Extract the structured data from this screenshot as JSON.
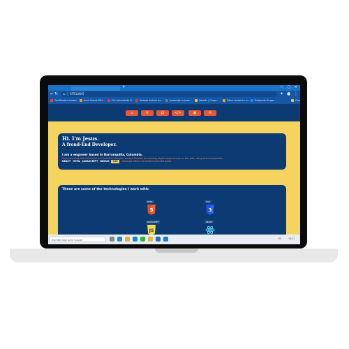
{
  "browser": {
    "tab_title": "SITELINKS",
    "new_tab_glyph": "+",
    "window_controls": "— ▢ ✕",
    "url_text": "① ⓘ SITELINKS",
    "bookmarks": [
      {
        "label": "Certificados Acaden...",
        "color": "#e74c3c"
      },
      {
        "label": "Acad Virtual IPN I...",
        "color": "#f39c12"
      },
      {
        "label": "Clic Actualizado G...",
        "color": "#e53935"
      },
      {
        "label": "Portada Archivo de...",
        "color": "#e53935"
      },
      {
        "label": "Javascript vs Java:...",
        "color": "#607d8b"
      },
      {
        "label": "Gestión | Grupo...",
        "color": "#fbc02d"
      },
      {
        "label": "Cómo vender tu cu...",
        "color": "#f39c12"
      },
      {
        "label": "Endpoints Grupo...",
        "color": "#1e88e5"
      },
      {
        "label": "Otros",
        "color": "#fbc02d"
      }
    ]
  },
  "nav": {
    "items": [
      {
        "icon": "home-icon",
        "glyph": "⌂"
      },
      {
        "icon": "user-icon",
        "glyph": "♀"
      },
      {
        "icon": "document-icon",
        "glyph": "▤"
      },
      {
        "icon": "code-icon",
        "glyph": "</>"
      },
      {
        "icon": "briefcase-icon",
        "glyph": "▣"
      },
      {
        "icon": "contact-icon",
        "glyph": "✉"
      }
    ]
  },
  "hero": {
    "greeting": "Hi. I'm Jesus.",
    "role": "A frond-End Developer.",
    "intro": "I am a engineer based in Barranquilla, Colombia.",
    "description": "Enjoy working with functional and beautiful designs, always focused on creating digital experiences on the web, using technologies like",
    "techs": [
      "REACT",
      "HTML",
      "JAVASCRIPT",
      "REDUX",
      "CSS"
    ],
    "highlight_tech": "CSS",
    "tail": "amongst others to achieve planned goals."
  },
  "technologies": {
    "heading": "These are some of the technologies I work with:",
    "items": [
      {
        "label": "HTML",
        "icon": "html5-icon",
        "color": "#e44d26"
      },
      {
        "label": "CSS",
        "icon": "css3-icon",
        "color": "#264de4"
      },
      {
        "label": "JAVASCRIPT",
        "icon": "javascript-icon",
        "color": "#f0db4f"
      },
      {
        "label": "REACT",
        "icon": "react-icon",
        "color": "#61dafb"
      }
    ]
  },
  "taskbar": {
    "search_placeholder": "Escribe aquí para buscar",
    "tray_text": "ES",
    "time": "10:21"
  },
  "colors": {
    "page_background": "#f4d35e",
    "card_background": "#0c3b73",
    "accent": "#e6573b"
  }
}
